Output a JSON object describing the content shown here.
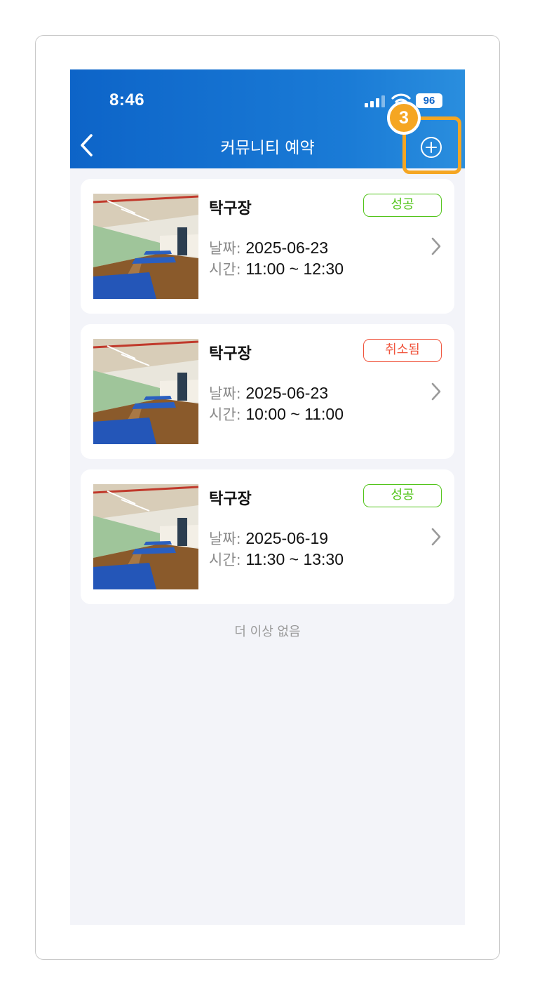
{
  "status_bar": {
    "time": "8:46",
    "battery": "96"
  },
  "header": {
    "title": "커뮤니티 예약"
  },
  "tutorial": {
    "step": "3"
  },
  "labels": {
    "date": "날짜: ",
    "time": "시간: "
  },
  "reservations": [
    {
      "name": "탁구장",
      "status": "성공",
      "date": "2025-06-23",
      "time": "11:00 ~ 12:30"
    },
    {
      "name": "탁구장",
      "status": "취소됨",
      "date": "2025-06-23",
      "time": "10:00 ~ 11:00"
    },
    {
      "name": "탁구장",
      "status": "성공",
      "date": "2025-06-19",
      "time": "11:30 ~ 13:30"
    }
  ],
  "footer": {
    "end_text": "더 이상 없음"
  },
  "colors": {
    "header_blue": "#0d64c8",
    "success_green": "#52c41a",
    "cancel_red": "#f0543c",
    "highlight_orange": "#f5a623"
  }
}
